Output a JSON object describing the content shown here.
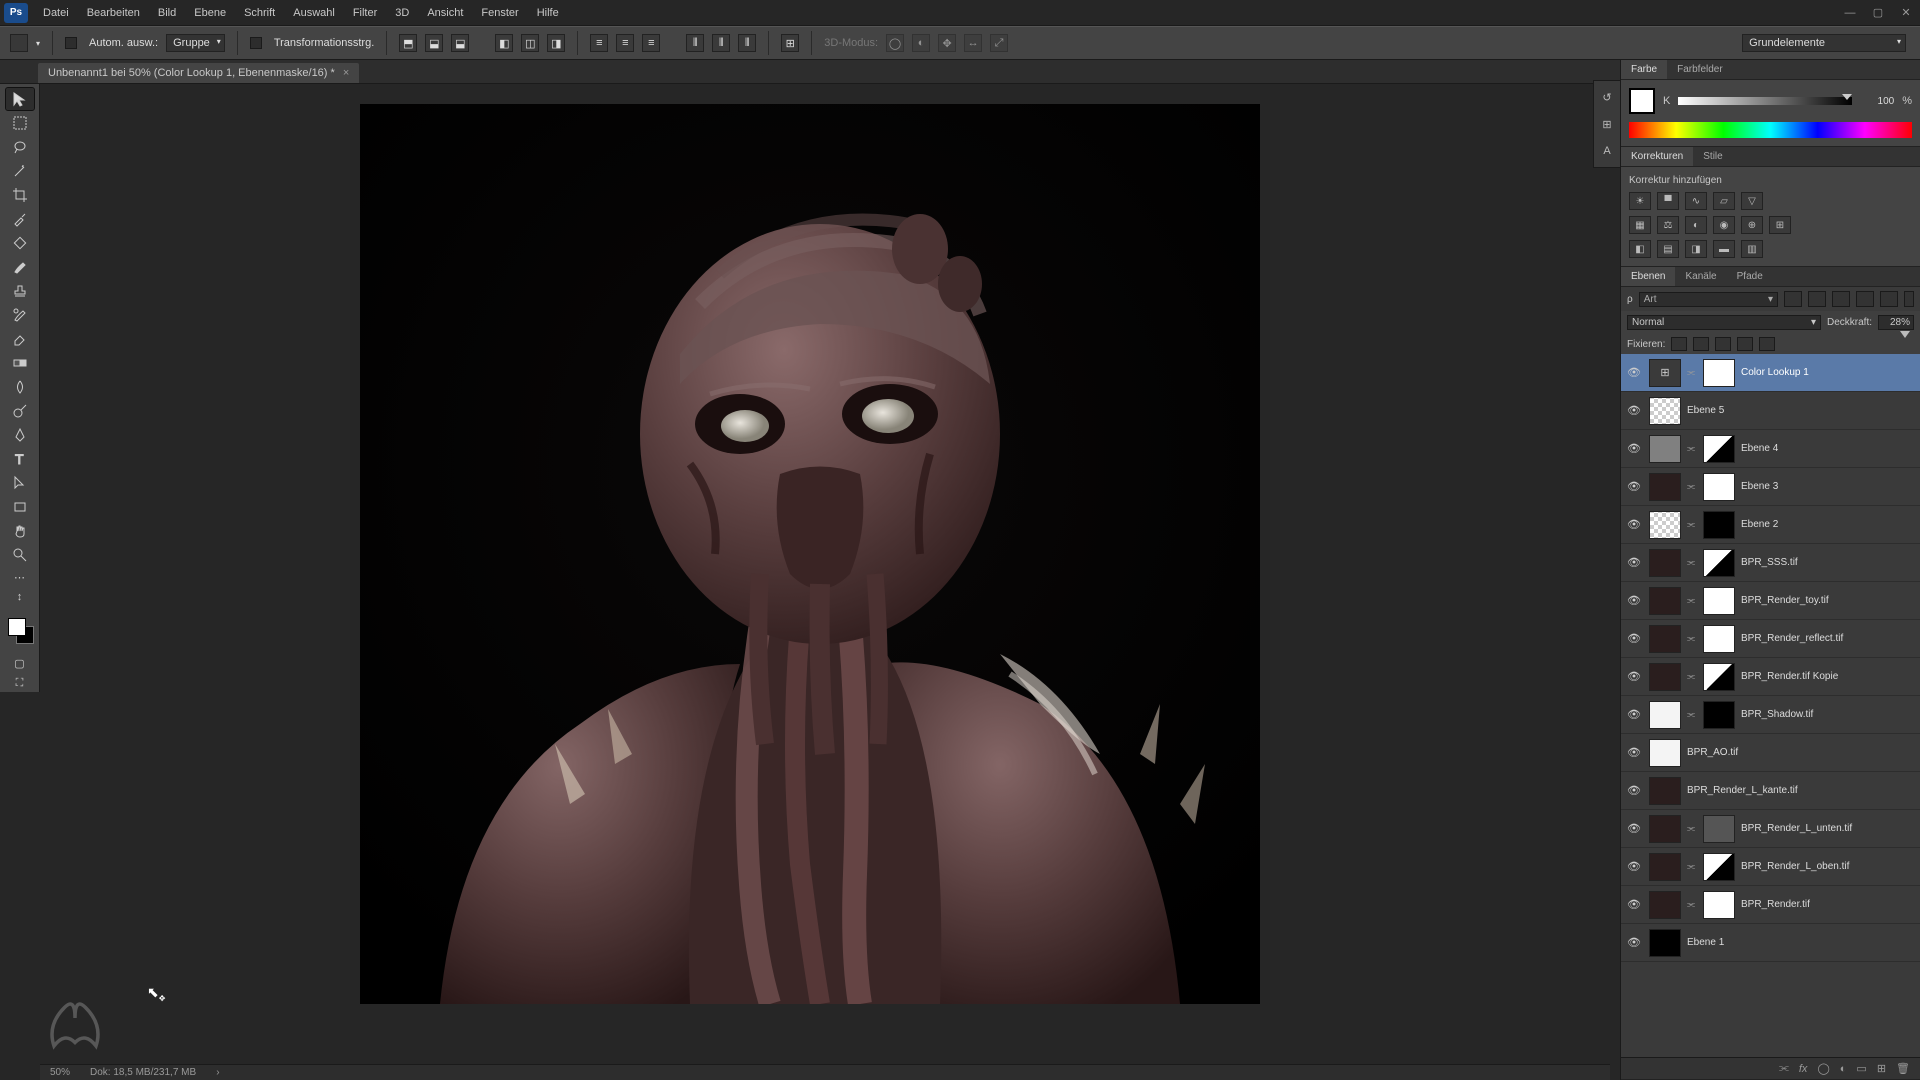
{
  "app_logo": "Ps",
  "menu": [
    "Datei",
    "Bearbeiten",
    "Bild",
    "Ebene",
    "Schrift",
    "Auswahl",
    "Filter",
    "3D",
    "Ansicht",
    "Fenster",
    "Hilfe"
  ],
  "options": {
    "auto_select": "Autom. ausw.:",
    "group": "Gruppe",
    "transform": "Transformationsstrg.",
    "mode3d": "3D-Modus:",
    "right_dd": "Grundelemente"
  },
  "doc_tab": "Unbenannt1 bei 50% (Color Lookup 1, Ebenenmaske/16) *",
  "status": {
    "zoom": "50%",
    "docinfo": "Dok: 18,5 MB/231,7 MB"
  },
  "panels": {
    "farbe_tabs": [
      "Farbe",
      "Farbfelder"
    ],
    "k_label": "K",
    "k_value": "100",
    "k_pct": "%",
    "korrekturen_tabs": [
      "Korrekturen",
      "Stile"
    ],
    "korrekturen_hint": "Korrektur hinzufügen",
    "ebenen_tabs": [
      "Ebenen",
      "Kanäle",
      "Pfade"
    ],
    "search_kind": "Art",
    "blend_mode": "Normal",
    "opacity_label": "Deckkraft:",
    "opacity_value": "28%",
    "lock_label": "Fixieren:"
  },
  "layers": [
    {
      "name": "Color Lookup 1",
      "thumb": "adj",
      "mask": "white",
      "selected": true,
      "link": true
    },
    {
      "name": "Ebene 5",
      "thumb": "transp"
    },
    {
      "name": "Ebene 4",
      "thumb": "gray",
      "mask": "half",
      "link": true
    },
    {
      "name": "Ebene 3",
      "thumb": "dark",
      "mask": "white",
      "link": true
    },
    {
      "name": "Ebene 2",
      "thumb": "transp",
      "mask": "dark",
      "link": true
    },
    {
      "name": "BPR_SSS.tif",
      "thumb": "dark",
      "mask": "half",
      "link": true
    },
    {
      "name": "BPR_Render_toy.tif",
      "thumb": "dark",
      "mask": "white",
      "link": true
    },
    {
      "name": "BPR_Render_reflect.tif",
      "thumb": "dark",
      "mask": "white",
      "link": true
    },
    {
      "name": "BPR_Render.tif Kopie",
      "thumb": "dark",
      "mask": "half",
      "link": true
    },
    {
      "name": "BPR_Shadow.tif",
      "thumb": "white",
      "mask": "dark",
      "link": true
    },
    {
      "name": "BPR_AO.tif",
      "thumb": "white"
    },
    {
      "name": "BPR_Render_L_kante.tif",
      "thumb": "dark"
    },
    {
      "name": "BPR_Render_L_unten.tif",
      "thumb": "dark",
      "mask": "gray",
      "link": true
    },
    {
      "name": "BPR_Render_L_oben.tif",
      "thumb": "dark",
      "mask": "half",
      "link": true
    },
    {
      "name": "BPR_Render.tif",
      "thumb": "dark",
      "mask": "white",
      "link": true
    },
    {
      "name": "Ebene 1",
      "thumb": "black"
    }
  ]
}
